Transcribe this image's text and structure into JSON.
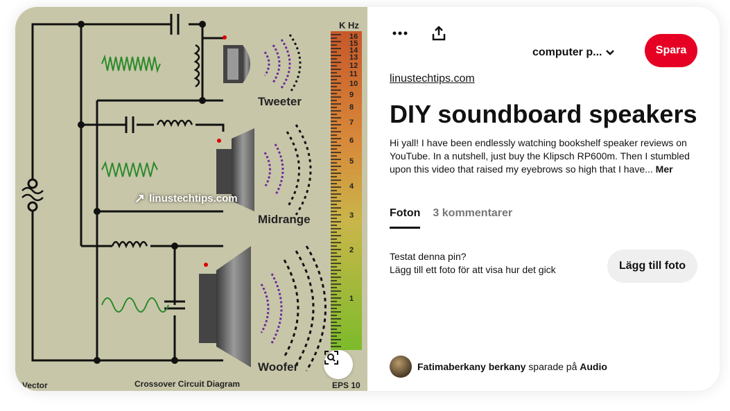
{
  "image": {
    "labels": {
      "khz": "K Hz",
      "tweeter": "Tweeter",
      "midrange": "Midrange",
      "woofer": "Woofer",
      "vector": "Vector",
      "caption": "Crossover Circuit Diagram",
      "eps": "EPS 10"
    },
    "scale_ticks": [
      "16",
      "15",
      "14",
      "13",
      "12",
      "11",
      "10",
      "9",
      "8",
      "7",
      "6",
      "5",
      "4",
      "3",
      "2",
      "1"
    ],
    "source_overlay": "linustechtips.com"
  },
  "toolbar": {
    "more_icon": "more-icon",
    "share_icon": "share-icon",
    "board_name": "computer p...",
    "save_label": "Spara"
  },
  "pin": {
    "source_link": "linustechtips.com",
    "title": "DIY soundboard speakers",
    "description": "Hi yall! I have been endlessly watching bookshelf speaker reviews on YouTube. In a nutshell, just buy the Klipsch RP600m. Then I stumbled upon this video that raised my eyebrows so high that I have...",
    "more_label": "Mer"
  },
  "tabs": [
    {
      "label": "Foton",
      "active": true
    },
    {
      "label": "3 kommentarer",
      "active": false
    }
  ],
  "tried": {
    "line1": "Testat denna pin?",
    "line2": "Lägg till ett foto för att visa hur det gick",
    "button": "Lägg till foto"
  },
  "saver": {
    "name": "Fatimaberkany berkany",
    "action": "sparade på",
    "board": "Audio"
  },
  "colors": {
    "save": "#e60023",
    "image_bg": "#c8c6a9"
  }
}
